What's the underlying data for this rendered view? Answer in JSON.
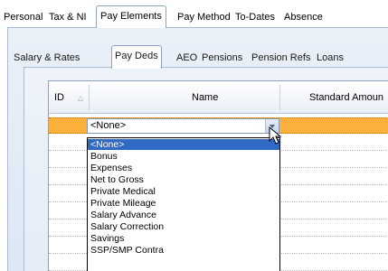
{
  "top_tabs": [
    {
      "label": "Personal"
    },
    {
      "label": "Tax & NI"
    },
    {
      "label": "Pay Elements"
    },
    {
      "label": "Pay Method"
    },
    {
      "label": "To-Dates"
    },
    {
      "label": "Absence"
    }
  ],
  "inner_tabs": [
    {
      "label": "Salary & Rates"
    },
    {
      "label": "Pay Deds"
    },
    {
      "label": "AEO"
    },
    {
      "label": "Pensions"
    },
    {
      "label": "Pension Refs"
    },
    {
      "label": "Loans"
    }
  ],
  "grid": {
    "columns": [
      {
        "label": "ID"
      },
      {
        "label": "Name"
      },
      {
        "label": "Standard Amoun"
      }
    ],
    "sort_icon": "sort-ascending-icon"
  },
  "combo": {
    "value": "<None>",
    "icon": "chevron-down-icon"
  },
  "dropdown": {
    "items": [
      {
        "label": "<None>"
      },
      {
        "label": "Bonus"
      },
      {
        "label": "Expenses"
      },
      {
        "label": "Net to Gross"
      },
      {
        "label": "Private Medical"
      },
      {
        "label": "Private Mileage"
      },
      {
        "label": "Salary Advance"
      },
      {
        "label": "Salary Correction"
      },
      {
        "label": "Savings"
      },
      {
        "label": "SSP/SMP Contra"
      }
    ],
    "highlighted": "<None>"
  },
  "colors": {
    "selected_row": "#fbb03b",
    "list_highlight": "#316ac5",
    "tab_border": "#8aa2c4"
  }
}
